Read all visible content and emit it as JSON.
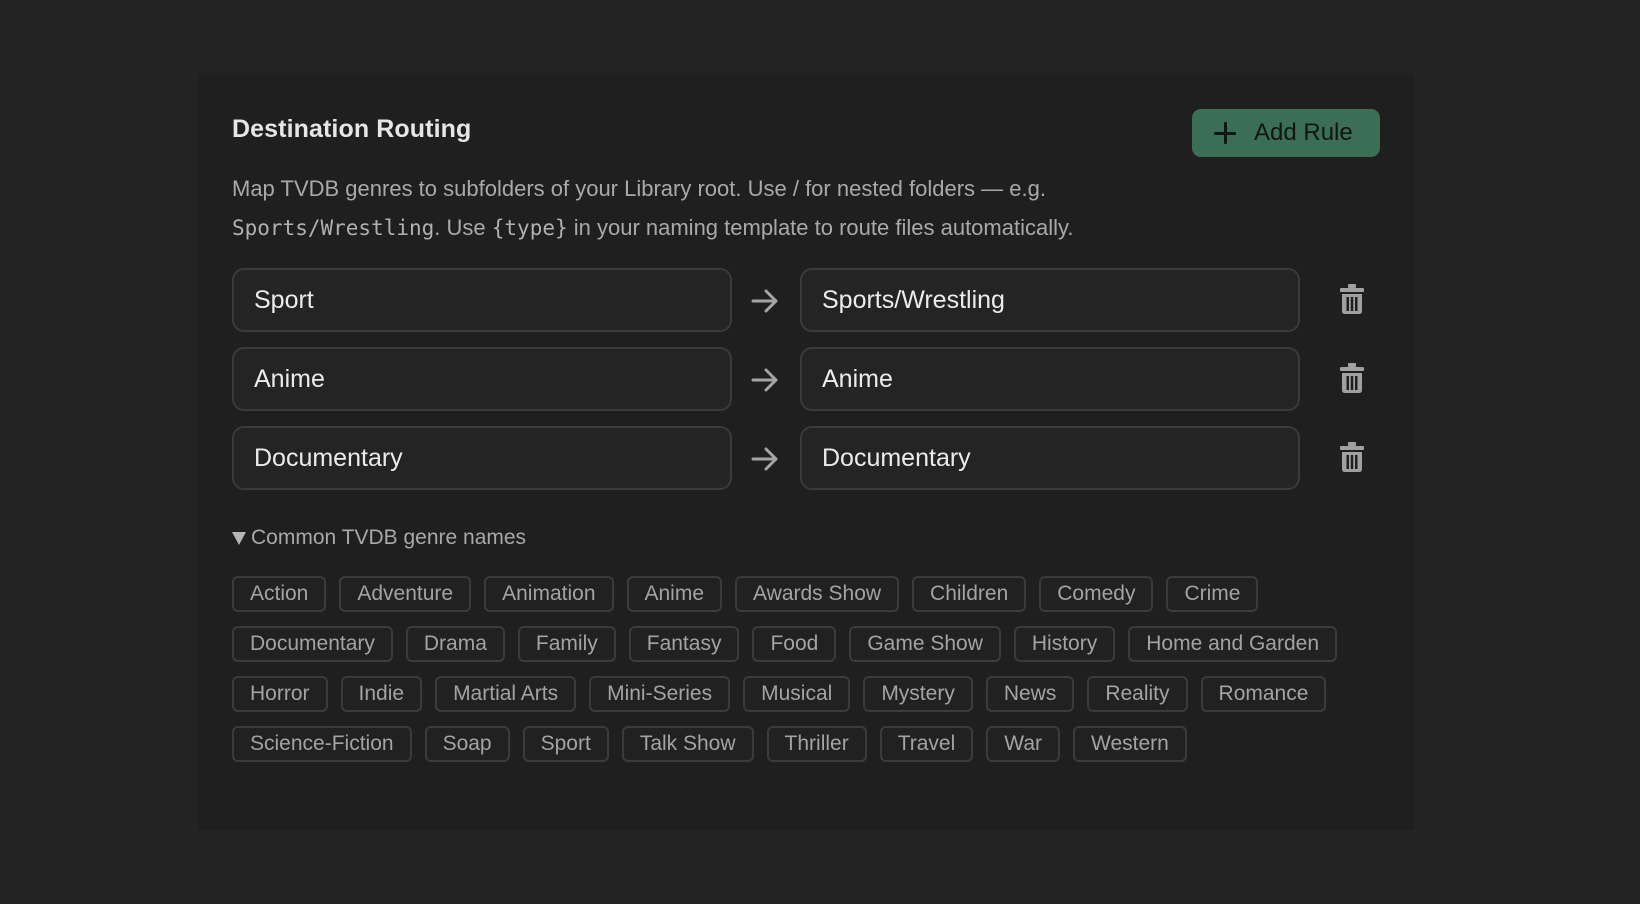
{
  "panel": {
    "title": "Destination Routing",
    "add_button_label": "Add Rule",
    "description": {
      "part1": "Map TVDB genres to subfolders of your Library root. Use / for nested folders — e.g.",
      "code1": "Sports/Wrestling",
      "part2": ". Use ",
      "code2": "{type}",
      "part3": " in your naming template to route files automatically."
    }
  },
  "rules": [
    {
      "genre": "Sport",
      "folder": "Sports/Wrestling"
    },
    {
      "genre": "Anime",
      "folder": "Anime"
    },
    {
      "genre": "Documentary",
      "folder": "Documentary"
    }
  ],
  "genres_section": {
    "summary": "Common TVDB genre names",
    "expanded": true,
    "genres": [
      "Action",
      "Adventure",
      "Animation",
      "Anime",
      "Awards Show",
      "Children",
      "Comedy",
      "Crime",
      "Documentary",
      "Drama",
      "Family",
      "Fantasy",
      "Food",
      "Game Show",
      "History",
      "Home and Garden",
      "Horror",
      "Indie",
      "Martial Arts",
      "Mini-Series",
      "Musical",
      "Mystery",
      "News",
      "Reality",
      "Romance",
      "Science-Fiction",
      "Soap",
      "Sport",
      "Talk Show",
      "Thriller",
      "Travel",
      "War",
      "Western"
    ]
  },
  "icons": {
    "add": "plus-icon",
    "arrow": "arrow-right-icon",
    "delete": "trash-icon",
    "disclosure": "triangle-down-icon"
  },
  "colors": {
    "accent": "#3b6f55",
    "background": "#232323",
    "panel": "#1f1f1f"
  }
}
